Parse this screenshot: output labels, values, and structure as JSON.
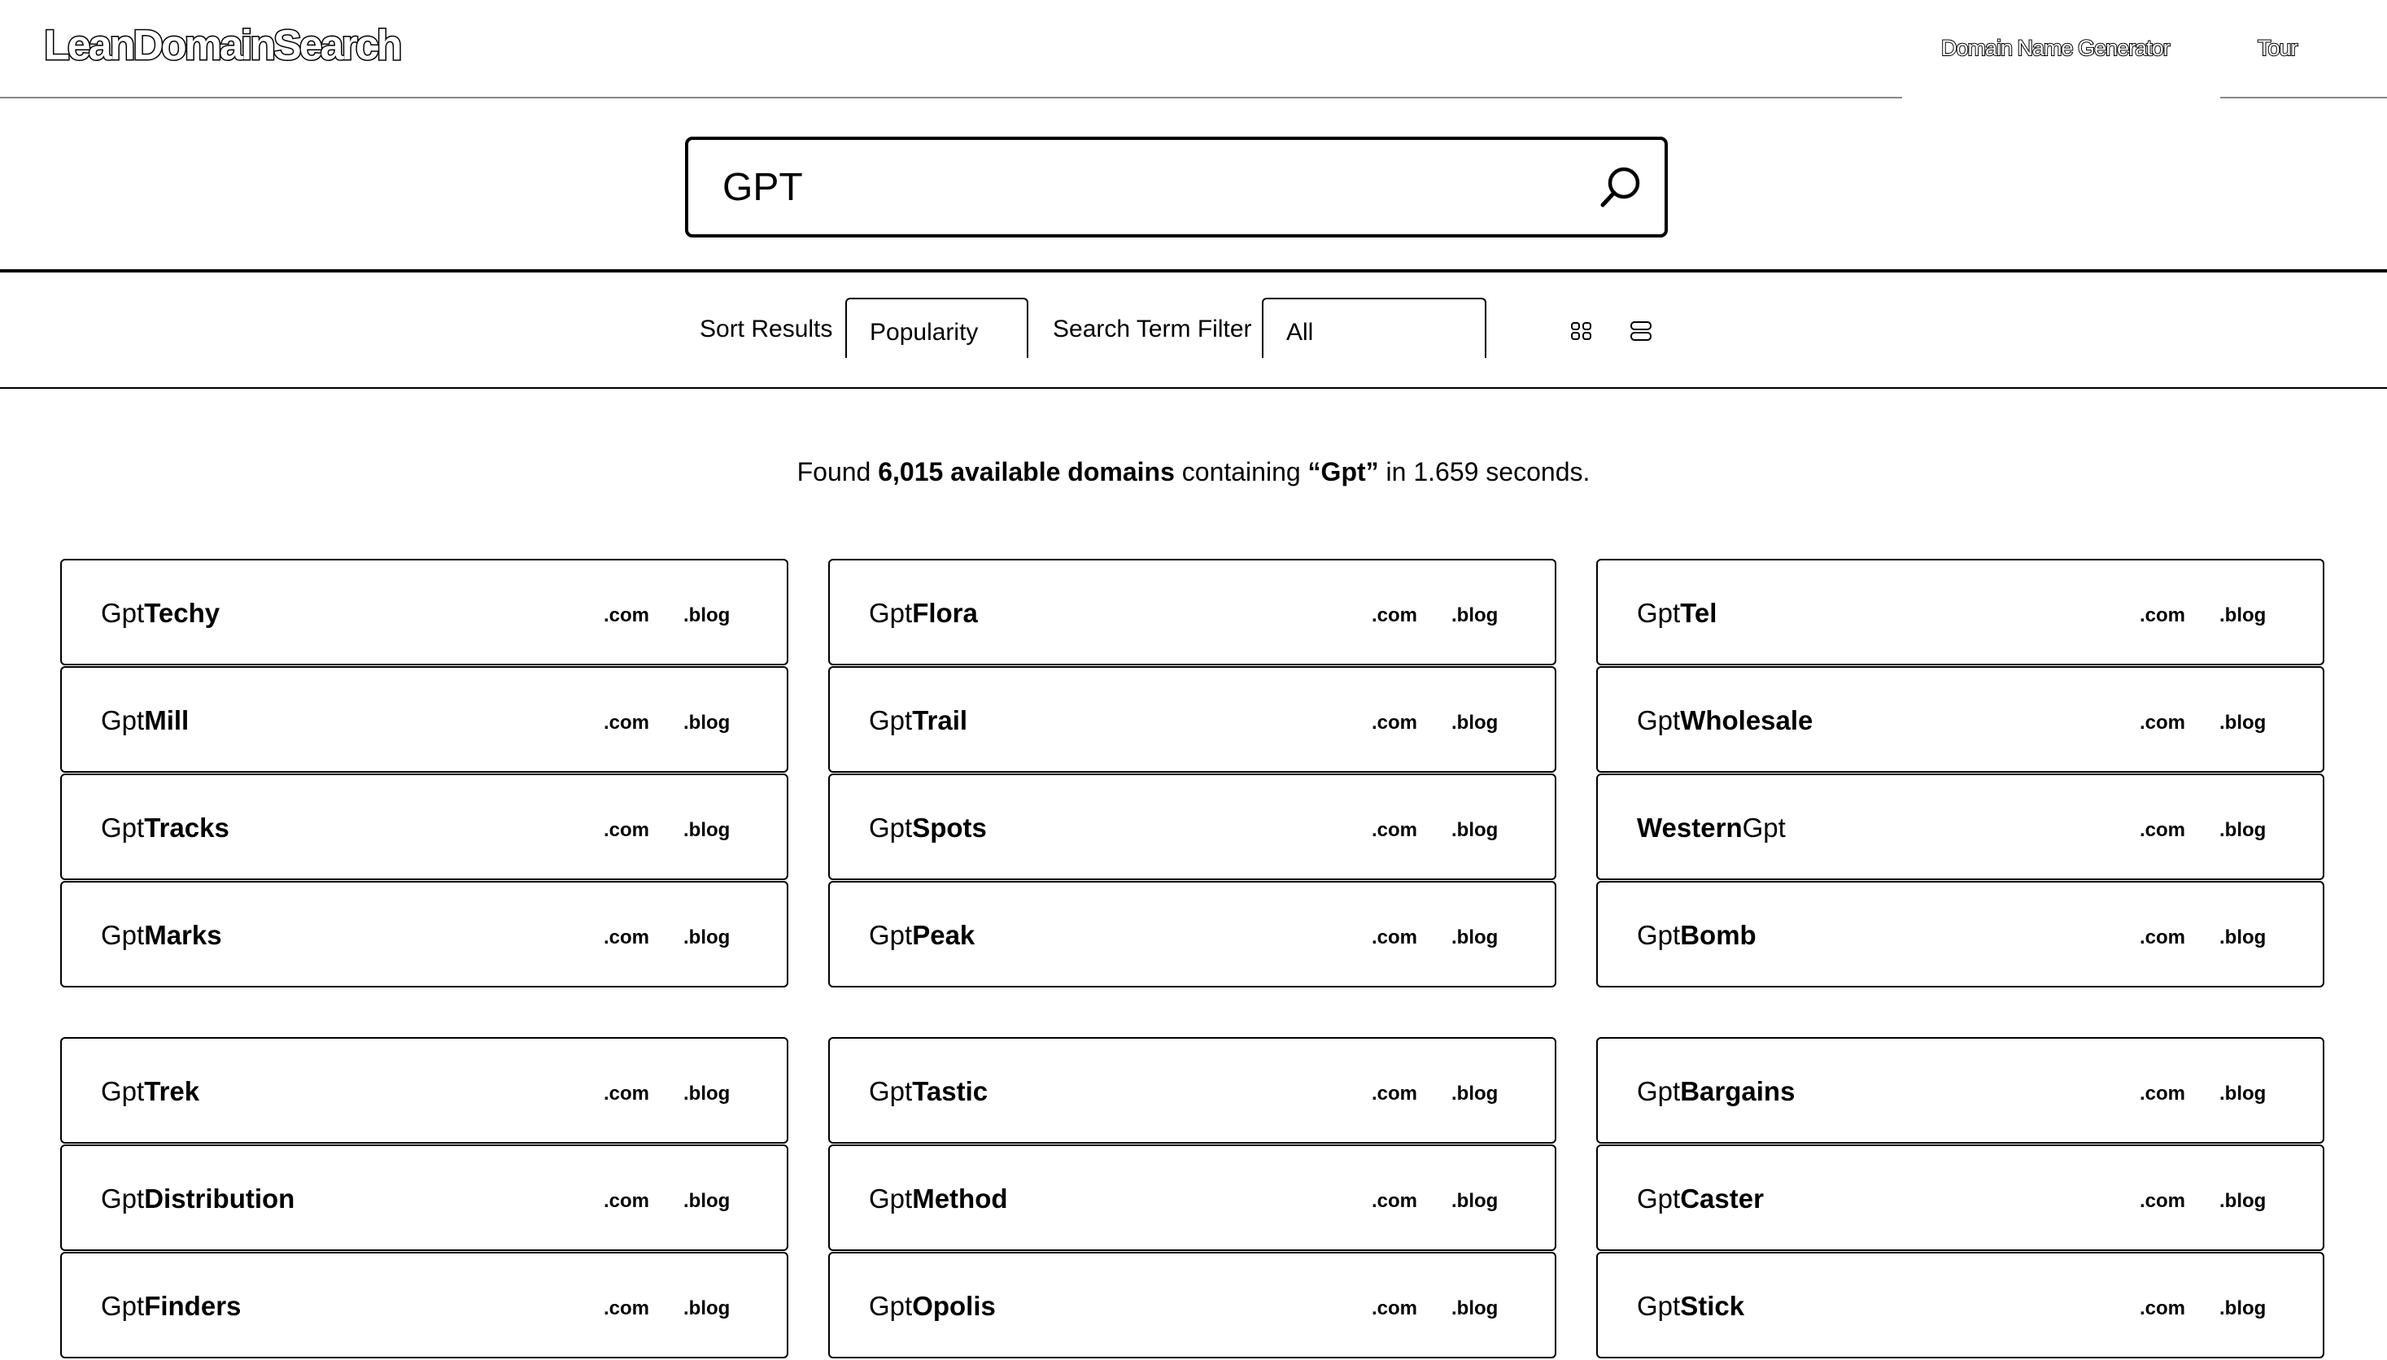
{
  "header": {
    "logo": "LeanDomainSearch",
    "nav": [
      "Domain Name Generator",
      "Tour"
    ]
  },
  "search": {
    "value": "GPT"
  },
  "toolbar": {
    "sort_label": "Sort Results",
    "sort_value": "Popularity",
    "filter_label": "Search Term Filter",
    "filter_value": "All"
  },
  "summary": {
    "prefix": "Found ",
    "count": "6,015 available domains",
    "middle": " containing ",
    "term": "“Gpt”",
    "suffix": " in 1.659 seconds."
  },
  "tlds": [
    ".com",
    ".blog"
  ],
  "results": [
    [
      [
        [
          "Gpt",
          "Techy",
          1
        ],
        [
          "Gpt",
          "Flora",
          1
        ],
        [
          "Gpt",
          "Tel",
          1
        ]
      ],
      [
        [
          "Gpt",
          "Mill",
          1
        ],
        [
          "Gpt",
          "Trail",
          1
        ],
        [
          "Gpt",
          "Wholesale",
          1
        ]
      ],
      [
        [
          "Gpt",
          "Tracks",
          1
        ],
        [
          "Gpt",
          "Spots",
          1
        ],
        [
          "Western",
          "Gpt",
          0
        ]
      ],
      [
        [
          "Gpt",
          "Marks",
          1
        ],
        [
          "Gpt",
          "Peak",
          1
        ],
        [
          "Gpt",
          "Bomb",
          1
        ]
      ]
    ],
    [
      [
        [
          "Gpt",
          "Trek",
          1
        ],
        [
          "Gpt",
          "Tastic",
          1
        ],
        [
          "Gpt",
          "Bargains",
          1
        ]
      ],
      [
        [
          "Gpt",
          "Distribution",
          1
        ],
        [
          "Gpt",
          "Method",
          1
        ],
        [
          "Gpt",
          "Caster",
          1
        ]
      ],
      [
        [
          "Gpt",
          "Finders",
          1
        ],
        [
          "Gpt",
          "Opolis",
          1
        ],
        [
          "Gpt",
          "Stick",
          1
        ]
      ]
    ]
  ]
}
